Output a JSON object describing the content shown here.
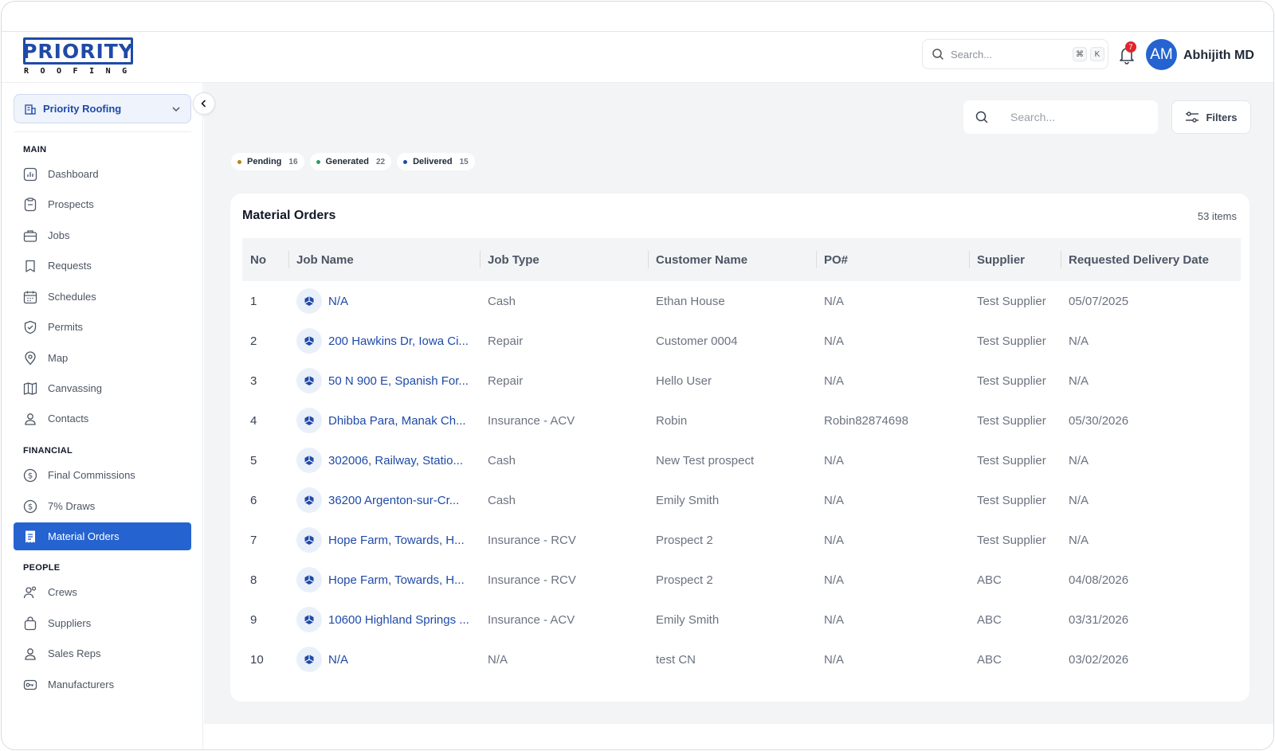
{
  "header": {
    "logo_text": "PRIORITY",
    "logo_sub": "ROOFING",
    "search_placeholder": "Search...",
    "kbd_cmd": "⌘",
    "kbd_k": "K",
    "notification_count": "7",
    "avatar_initials": "AM",
    "user_name": "Abhijith MD"
  },
  "sidebar": {
    "org_name": "Priority Roofing",
    "sections": {
      "main": "MAIN",
      "financial": "FINANCIAL",
      "people": "PEOPLE"
    },
    "main_items": [
      {
        "label": "Dashboard",
        "icon": "chart-icon"
      },
      {
        "label": "Prospects",
        "icon": "clipboard-icon"
      },
      {
        "label": "Jobs",
        "icon": "briefcase-icon"
      },
      {
        "label": "Requests",
        "icon": "bookmark-icon"
      },
      {
        "label": "Schedules",
        "icon": "calendar-icon"
      },
      {
        "label": "Permits",
        "icon": "shield-check-icon"
      },
      {
        "label": "Map",
        "icon": "map-pin-icon"
      },
      {
        "label": "Canvassing",
        "icon": "map-icon"
      },
      {
        "label": "Contacts",
        "icon": "user-icon"
      }
    ],
    "financial_items": [
      {
        "label": "Final Commissions",
        "icon": "dollar-circle-icon"
      },
      {
        "label": "7% Draws",
        "icon": "dollar-circle-icon"
      },
      {
        "label": "Material Orders",
        "icon": "receipt-icon",
        "active": true
      }
    ],
    "people_items": [
      {
        "label": "Crews",
        "icon": "users-icon"
      },
      {
        "label": "Suppliers",
        "icon": "bag-icon"
      },
      {
        "label": "Sales Reps",
        "icon": "user-icon"
      },
      {
        "label": "Manufacturers",
        "icon": "key-icon"
      }
    ]
  },
  "main": {
    "search_placeholder": "Search...",
    "filters_label": "Filters",
    "chips": [
      {
        "label": "Pending",
        "count": "16",
        "color": "#b8860b"
      },
      {
        "label": "Generated",
        "count": "22",
        "color": "#2e9b5f"
      },
      {
        "label": "Delivered",
        "count": "15",
        "color": "#1f4aa8"
      }
    ],
    "card_title": "Material Orders",
    "item_count": "53 items",
    "columns": [
      "No",
      "Job Name",
      "Job Type",
      "Customer Name",
      "PO#",
      "Supplier",
      "Requested Delivery Date"
    ],
    "rows": [
      {
        "no": "1",
        "job": "N/A",
        "type": "Cash",
        "customer": "Ethan House",
        "po": "N/A",
        "supplier": "Test Supplier",
        "date": "05/07/2025"
      },
      {
        "no": "2",
        "job": "200 Hawkins Dr, Iowa Ci...",
        "type": "Repair",
        "customer": "Customer 0004",
        "po": "N/A",
        "supplier": "Test Supplier",
        "date": "N/A"
      },
      {
        "no": "3",
        "job": "50 N 900 E, Spanish For...",
        "type": "Repair",
        "customer": "Hello User",
        "po": "N/A",
        "supplier": "Test Supplier",
        "date": "N/A"
      },
      {
        "no": "4",
        "job": "Dhibba Para, Manak Ch...",
        "type": "Insurance - ACV",
        "customer": "Robin",
        "po": "Robin82874698",
        "supplier": "Test Supplier",
        "date": "05/30/2026"
      },
      {
        "no": "5",
        "job": "302006, Railway, Statio...",
        "type": "Cash",
        "customer": "New Test prospect",
        "po": "N/A",
        "supplier": "Test Supplier",
        "date": "N/A"
      },
      {
        "no": "6",
        "job": "36200 Argenton-sur-Cr...",
        "type": "Cash",
        "customer": "Emily Smith",
        "po": "N/A",
        "supplier": "Test Supplier",
        "date": "N/A"
      },
      {
        "no": "7",
        "job": "Hope Farm, Towards, H...",
        "type": "Insurance - RCV",
        "customer": "Prospect 2",
        "po": "N/A",
        "supplier": "Test Supplier",
        "date": "N/A"
      },
      {
        "no": "8",
        "job": "Hope Farm, Towards, H...",
        "type": "Insurance - RCV",
        "customer": "Prospect 2",
        "po": "N/A",
        "supplier": "ABC",
        "date": "04/08/2026"
      },
      {
        "no": "9",
        "job": "10600 Highland Springs ...",
        "type": "Insurance - ACV",
        "customer": "Emily Smith",
        "po": "N/A",
        "supplier": "ABC",
        "date": "03/31/2026"
      },
      {
        "no": "10",
        "job": "N/A",
        "type": "N/A",
        "customer": "test CN",
        "po": "N/A",
        "supplier": "ABC",
        "date": "03/02/2026"
      }
    ]
  }
}
